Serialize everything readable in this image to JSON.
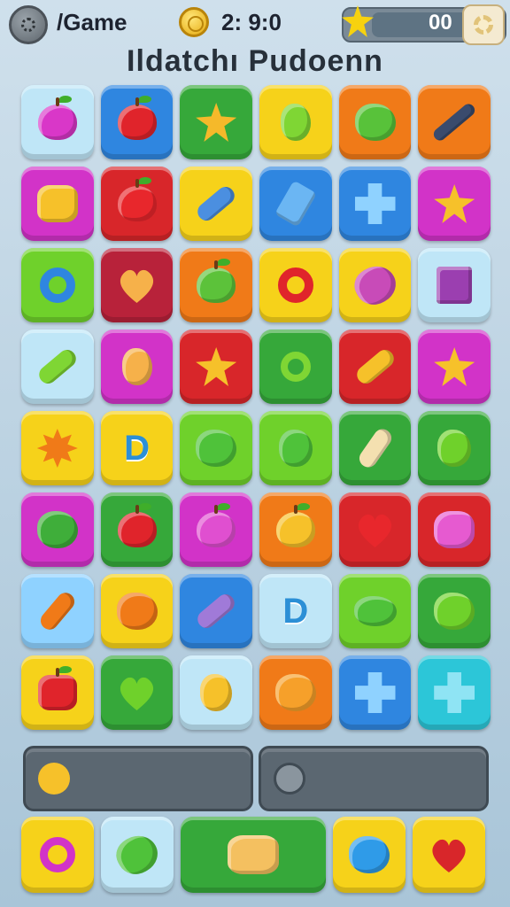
{
  "header": {
    "game_label": "/Game",
    "timer": "2: 9:0",
    "score": "00"
  },
  "title": "Ildatchı Pudoenn",
  "board": {
    "rows": 8,
    "cols": 6
  },
  "colors": {
    "yellow": "#f6d21a",
    "blue": "#2f86e0",
    "green": "#36a83a",
    "lime": "#6fd12b",
    "orange": "#f07a18",
    "red": "#d8262a",
    "magenta": "#d233c8",
    "cyan": "#2cc6d8",
    "paleblue": "#bfe6f7",
    "crimson": "#b8223a"
  }
}
